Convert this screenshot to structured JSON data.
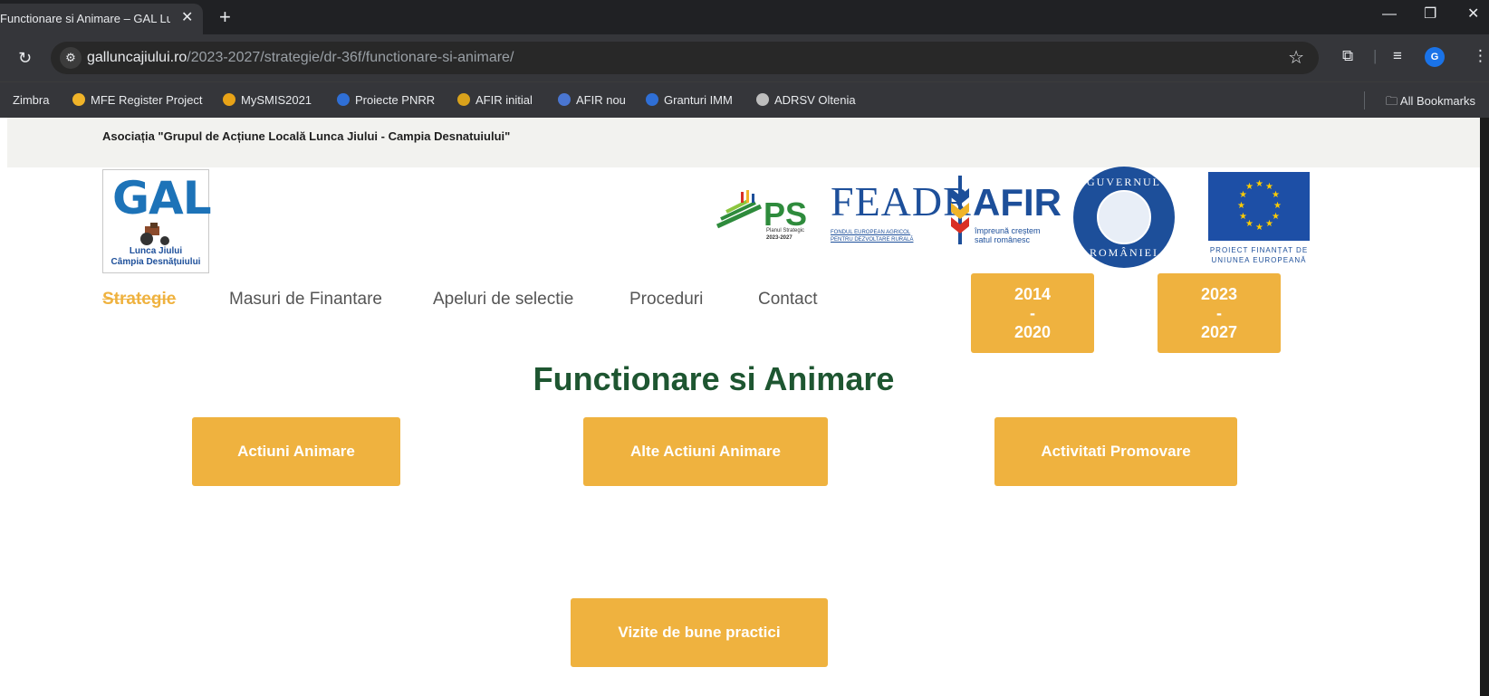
{
  "browser": {
    "tab_title": "Functionare si Animare – GAL Lu",
    "url_host": "galluncajiului.ro",
    "url_path": "/2023-2027/strategie/dr-36f/functionare-si-animare/",
    "profile_letter": "G",
    "bookmarks": [
      {
        "label": "Zimbra",
        "color": "#35363a"
      },
      {
        "label": "MFE Register Project",
        "color": "#f0b429"
      },
      {
        "label": "MySMIS2021",
        "color": "#e8a317"
      },
      {
        "label": "Proiecte PNRR",
        "color": "#2f6fd6"
      },
      {
        "label": "AFIR initial",
        "color": "#d9a21b"
      },
      {
        "label": "AFIR nou",
        "color": "#4a76d1"
      },
      {
        "label": "Granturi IMM",
        "color": "#2f6fd6"
      },
      {
        "label": "ADRSV Oltenia",
        "color": "#bdbdbd"
      }
    ],
    "all_bookmarks": "All Bookmarks",
    "icons": {
      "tab_close": "close-icon",
      "new_tab": "plus-icon",
      "reload": "reload-icon",
      "site_info": "tune-icon",
      "bookmark_star": "star-icon",
      "extensions": "puzzle-icon",
      "reading_list": "reading-list-icon",
      "menu": "kebab-menu-icon",
      "folder": "folder-icon"
    }
  },
  "site": {
    "org_name": "Asociația \"Grupul de Acțiune Locală Lunca Jiului - Campia Desnatuiului\"",
    "gal_logo": {
      "letters": "GAL",
      "line1": "Lunca Jiului",
      "line2": "Câmpia Desnățuiului"
    },
    "ps_logo": {
      "mark": "PS",
      "line1": "Planul Strategic",
      "line2": "2023-2027"
    },
    "feadr_logo": {
      "mark": "FEADR",
      "line1": "FONDUL EUROPEAN AGRICOL",
      "line2": "PENTRU DEZVOLTARE RURALĂ"
    },
    "afir_logo": {
      "mark": "AFIR",
      "line1": "împreună creștem",
      "line2": "satul românesc"
    },
    "gov_logo": {
      "top": "GUVERNUL",
      "bottom": "ROMÂNIEI"
    },
    "eu_logo": {
      "line1": "PROIECT FINANȚAT DE",
      "line2": "UNIUNEA EUROPEANĂ"
    },
    "nav": [
      {
        "label": "Strategie",
        "active": true
      },
      {
        "label": "Masuri de Finantare",
        "active": false
      },
      {
        "label": "Apeluri de selectie",
        "active": false
      },
      {
        "label": "Proceduri",
        "active": false
      },
      {
        "label": "Contact",
        "active": false
      }
    ],
    "periods": [
      {
        "from": "2014",
        "dash": "-",
        "to": "2020"
      },
      {
        "from": "2023",
        "dash": "-",
        "to": "2027"
      }
    ],
    "page_title": "Functionare si Animare",
    "actions": [
      "Actiuni Animare",
      "Alte Actiuni Animare",
      "Activitati Promovare",
      "Vizite de bune practici"
    ],
    "colors": {
      "accent": "#efb23f",
      "title": "#1e5631",
      "nav_text": "#555555",
      "topbar": "#f2f2ef"
    }
  }
}
